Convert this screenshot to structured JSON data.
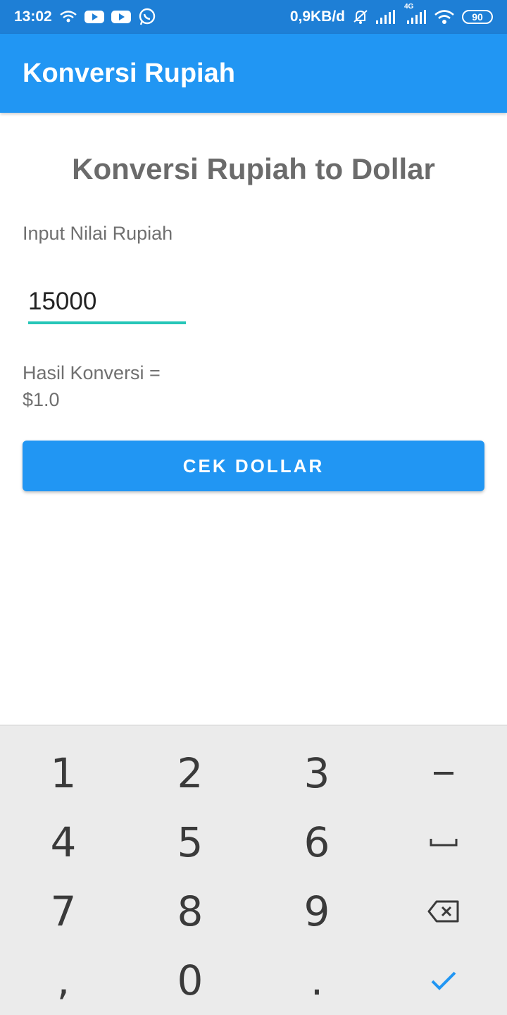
{
  "status_bar": {
    "time": "13:02",
    "network_speed": "0,9KB/d",
    "signal2_label": "4G",
    "battery": "90",
    "icons": [
      "wifi-calling-icon",
      "youtube-icon",
      "youtube-icon",
      "whatsapp-icon",
      "alarm-off-icon",
      "signal-icon",
      "signal-4g-icon",
      "wifi-icon",
      "battery-icon"
    ]
  },
  "app_bar": {
    "title": "Konversi Rupiah"
  },
  "main": {
    "heading": "Konversi Rupiah to Dollar",
    "input_label": "Input Nilai Rupiah",
    "input_value": "15000",
    "result_line1": "Hasil Konversi =",
    "result_line2": "$1.0",
    "button_label": "CEK DOLLAR"
  },
  "keyboard": {
    "keys": [
      "1",
      "2",
      "3",
      "–",
      "4",
      "5",
      "6",
      "␣",
      "7",
      "8",
      "9",
      "⌫",
      ",",
      "0",
      ".",
      "✓"
    ]
  },
  "colors": {
    "status_bar": "#1e7fd6",
    "accent": "#2196f3",
    "input_underline": "#26c6b8",
    "keyboard_bg": "#ebebeb",
    "done_key": "#2196f3"
  }
}
